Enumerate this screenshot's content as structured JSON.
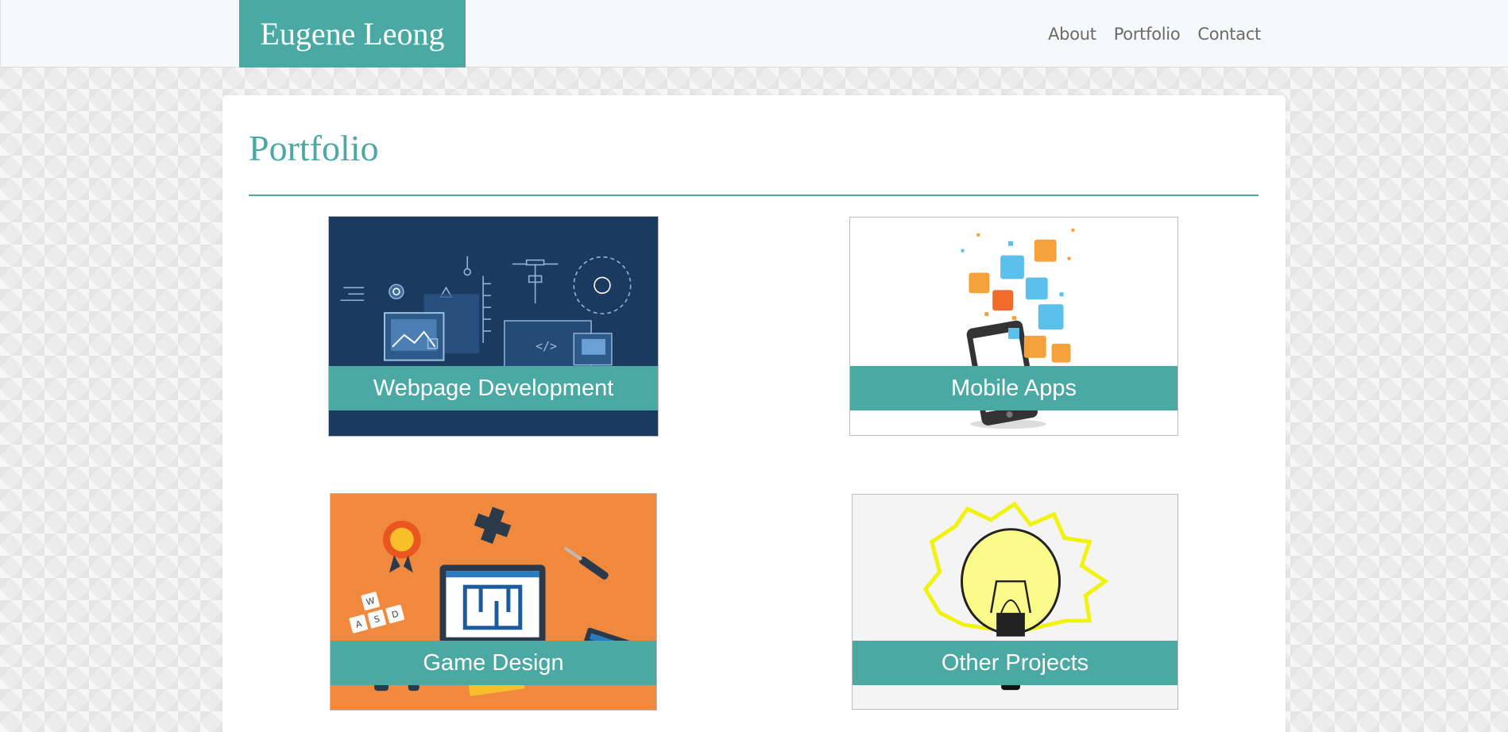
{
  "site": {
    "brand": "Eugene Leong"
  },
  "nav": {
    "items": [
      "About",
      "Portfolio",
      "Contact"
    ]
  },
  "page": {
    "title": "Portfolio"
  },
  "cards": [
    {
      "label": "Webpage Development",
      "art": "web-development-illustration"
    },
    {
      "label": "Mobile Apps",
      "art": "mobile-apps-illustration"
    },
    {
      "label": "Game Design",
      "art": "game-design-illustration"
    },
    {
      "label": "Other Projects",
      "art": "lightbulb-illustration"
    }
  ],
  "colors": {
    "accent": "#4aa9a3",
    "navbar_bg": "#f7f8f9",
    "web_card_bg": "#1a3a5f",
    "game_card_bg": "#f0883e"
  },
  "art_text": {
    "keys_top": "W",
    "keys_left": "A",
    "keys_mid": "S",
    "keys_right": "D",
    "code": "</>"
  }
}
